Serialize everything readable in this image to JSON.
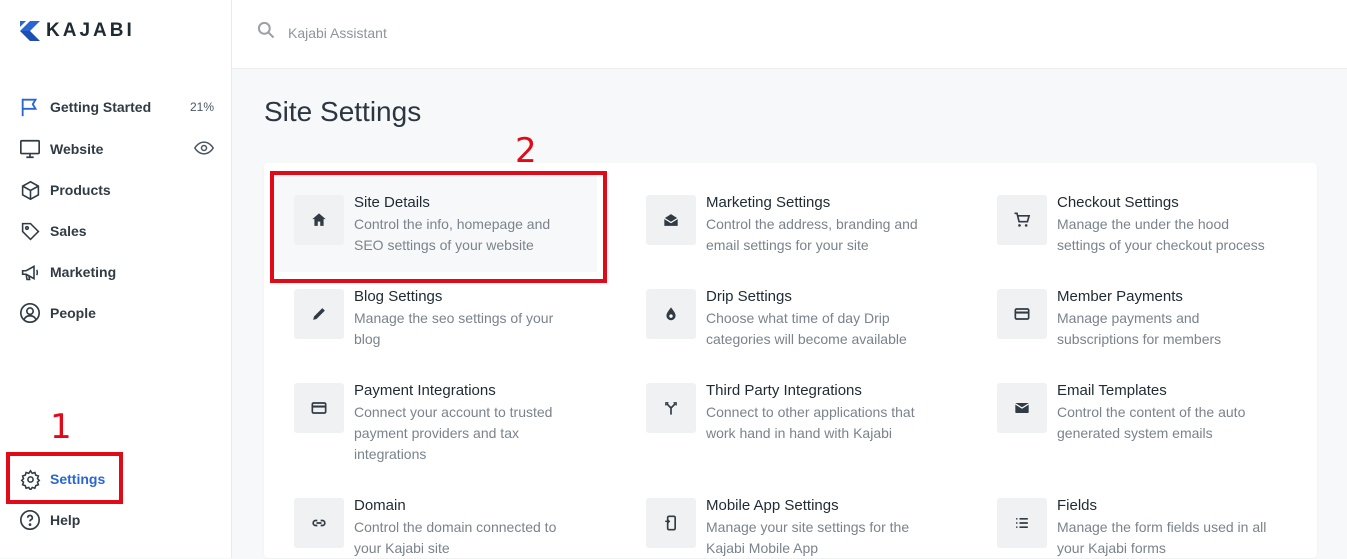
{
  "brand": {
    "name": "KAJABI",
    "accent": "#2a65d6"
  },
  "search": {
    "placeholder": "Kajabi Assistant"
  },
  "sidebar": {
    "items": [
      {
        "label": "Getting Started",
        "meta": "21%",
        "icon": "flag-icon"
      },
      {
        "label": "Website",
        "icon": "monitor-icon",
        "meta_icon": "eye-icon"
      },
      {
        "label": "Products",
        "icon": "cube-icon"
      },
      {
        "label": "Sales",
        "icon": "tag-icon"
      },
      {
        "label": "Marketing",
        "icon": "megaphone-icon"
      },
      {
        "label": "People",
        "icon": "user-circle-icon"
      }
    ],
    "settings": {
      "label": "Settings",
      "icon": "gear-icon"
    },
    "help": {
      "label": "Help",
      "icon": "help-circle-icon"
    }
  },
  "page": {
    "title": "Site Settings"
  },
  "settings_grid": [
    {
      "title": "Site Details",
      "desc": [
        "Control the info, homepage and",
        "SEO settings of your website"
      ],
      "icon": "home-icon"
    },
    {
      "title": "Marketing Settings",
      "desc": [
        "Control the address, branding and",
        "email settings for your site"
      ],
      "icon": "mail-open-icon"
    },
    {
      "title": "Checkout Settings",
      "desc": [
        "Manage the under the hood",
        "settings of your checkout process"
      ],
      "icon": "cart-icon"
    },
    {
      "title": "Blog Settings",
      "desc": [
        "Manage the seo settings of your",
        "blog"
      ],
      "icon": "pencil-icon"
    },
    {
      "title": "Drip Settings",
      "desc": [
        "Choose what time of day Drip",
        "categories will become available"
      ],
      "icon": "drop-icon"
    },
    {
      "title": "Member Payments",
      "desc": [
        "Manage payments and",
        "subscriptions for members"
      ],
      "icon": "credit-card-icon"
    },
    {
      "title": "Payment Integrations",
      "desc": [
        "Connect your account to trusted",
        "payment providers and tax",
        "integrations"
      ],
      "icon": "credit-card-icon"
    },
    {
      "title": "Third Party Integrations",
      "desc": [
        "Connect to other applications that",
        "work hand in hand with Kajabi"
      ],
      "icon": "merge-icon"
    },
    {
      "title": "Email Templates",
      "desc": [
        "Control the content of the auto",
        "generated system emails"
      ],
      "icon": "envelope-icon"
    },
    {
      "title": "Domain",
      "desc": [
        "Control the domain connected to",
        "your Kajabi site"
      ],
      "icon": "link-icon"
    },
    {
      "title": "Mobile App Settings",
      "desc": [
        "Manage your site settings for the",
        "Kajabi Mobile App"
      ],
      "icon": "mobile-icon"
    },
    {
      "title": "Fields",
      "desc": [
        "Manage the form fields used in all",
        "your Kajabi forms"
      ],
      "icon": "list-icon"
    }
  ],
  "annotations": {
    "step1": "1",
    "step2": "2",
    "color": "#e30a17"
  }
}
